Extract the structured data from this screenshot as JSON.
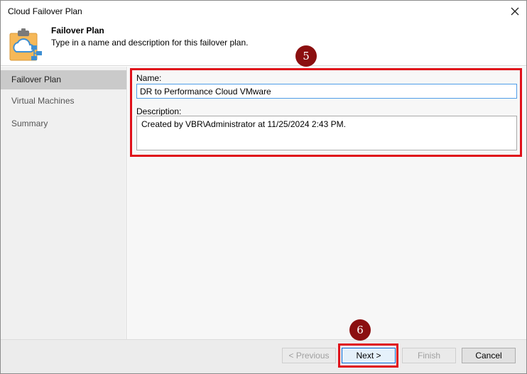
{
  "window": {
    "title": "Cloud Failover Plan"
  },
  "header": {
    "title": "Failover Plan",
    "subtitle": "Type in a name and description for this failover plan."
  },
  "sidebar": {
    "items": [
      {
        "label": "Failover Plan",
        "active": true
      },
      {
        "label": "Virtual Machines",
        "active": false
      },
      {
        "label": "Summary",
        "active": false
      }
    ]
  },
  "form": {
    "name_label": "Name:",
    "name_value": "DR to Performance Cloud VMware",
    "description_label": "Description:",
    "description_value": "Created by VBR\\Administrator at 11/25/2024 2:43 PM."
  },
  "annotations": {
    "step_form": "5",
    "step_next": "6"
  },
  "buttons": {
    "previous": "< Previous",
    "next": "Next >",
    "finish": "Finish",
    "cancel": "Cancel"
  },
  "colors": {
    "highlight": "#e0101a",
    "badge": "#8b0f10",
    "active_sidebar": "#cacaca"
  }
}
